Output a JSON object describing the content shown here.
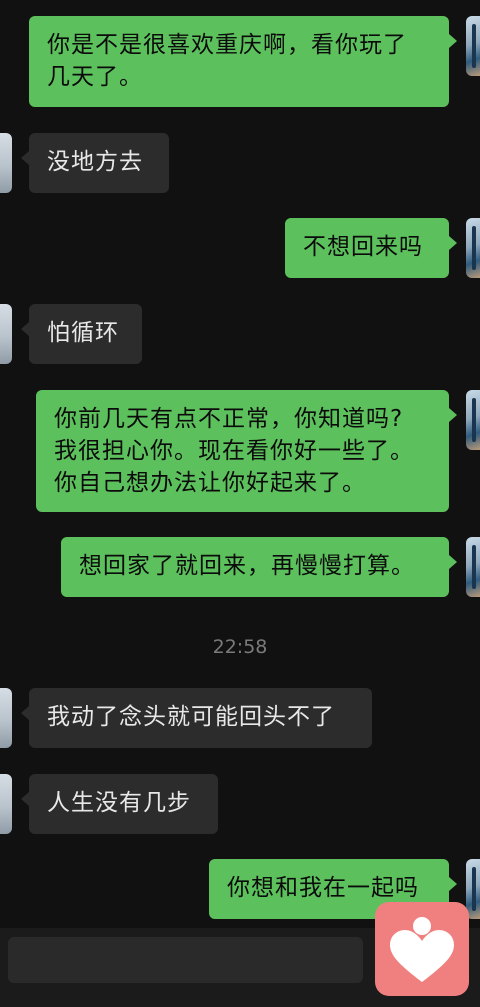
{
  "messages": [
    {
      "side": "out",
      "line1": "你是不是很喜欢重庆啊，看你玩了",
      "line2": "几天了。"
    },
    {
      "side": "in",
      "text": "没地方去"
    },
    {
      "side": "out",
      "text": "不想回来吗"
    },
    {
      "side": "in",
      "text": "怕循环"
    },
    {
      "side": "out",
      "line1": "你前几天有点不正常，你知道吗?",
      "line2": "我很担心你。现在看你好一些了。",
      "line3": "你自己想办法让你好起来了。"
    },
    {
      "side": "out",
      "text": "想回家了就回来，再慢慢打算。"
    },
    {
      "side": "in",
      "text": "我动了念头就可能回头不了"
    },
    {
      "side": "in",
      "text": "人生没有几步"
    },
    {
      "side": "out",
      "text": "你想和我在一起吗"
    }
  ],
  "timestamp": "22:58",
  "colors": {
    "outgoing_bubble": "#5cc15c",
    "incoming_bubble": "#2c2c2c",
    "background": "#111111",
    "overlay_icon": "#f08080"
  },
  "overlay_icon_name": "heart-person-icon"
}
